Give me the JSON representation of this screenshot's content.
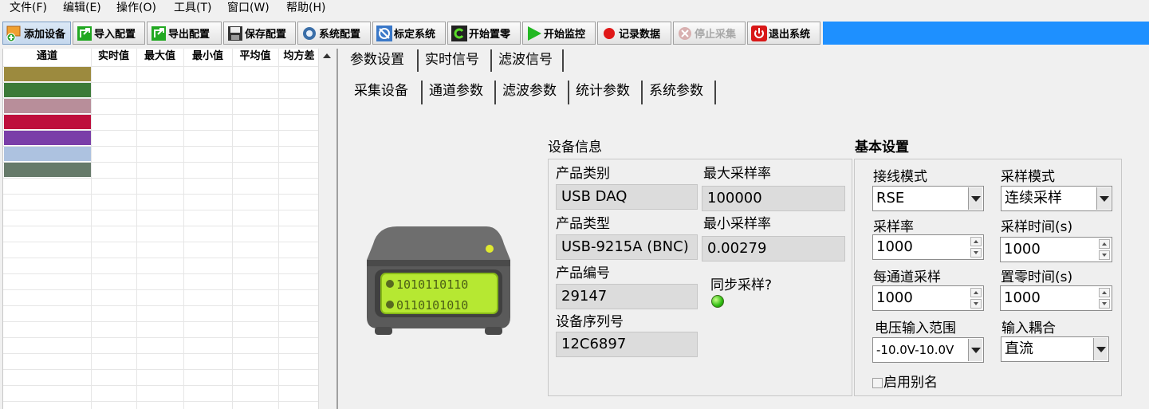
{
  "menu": [
    "文件(F)",
    "编辑(E)",
    "操作(O)",
    "工具(T)",
    "窗口(W)",
    "帮助(H)"
  ],
  "toolbar": {
    "buttons": [
      {
        "label": "添加设备",
        "icon": "add-device-icon",
        "active": true
      },
      {
        "label": "导入配置",
        "icon": "import-icon"
      },
      {
        "label": "导出配置",
        "icon": "export-icon"
      },
      {
        "label": "保存配置",
        "icon": "save-icon"
      },
      {
        "label": "系统配置",
        "icon": "system-config-icon"
      },
      {
        "label": "标定系统",
        "icon": "calibrate-icon"
      },
      {
        "label": "开始置零",
        "icon": "zero-icon"
      },
      {
        "label": "开始监控",
        "icon": "play-icon"
      },
      {
        "label": "记录数据",
        "icon": "record-icon"
      },
      {
        "label": "停止采集",
        "icon": "stop-icon",
        "disabled": true
      },
      {
        "label": "退出系统",
        "icon": "power-icon"
      }
    ],
    "colors": {
      "accent_bar": "#1e90ff"
    }
  },
  "table": {
    "columns": [
      "通道",
      "实时值",
      "最大值",
      "最小值",
      "平均值",
      "均方差"
    ],
    "channel_colors": [
      "#9c8a3e",
      "#3c7a38",
      "#b88e9a",
      "#be0e3c",
      "#7a3ea8",
      "#adc2e0",
      "#667a6a"
    ]
  },
  "tabs": {
    "main": [
      "参数设置",
      "实时信号",
      "滤波信号"
    ],
    "sub": [
      "采集设备",
      "通道参数",
      "滤波参数",
      "统计参数",
      "系统参数"
    ]
  },
  "device": {
    "title": "设备信息",
    "device_display": [
      "1010110110",
      "0110101010"
    ],
    "product_category_label": "产品类别",
    "product_category": "USB DAQ",
    "product_type_label": "产品类型",
    "product_type": "USB-9215A (BNC)",
    "product_number_label": "产品编号",
    "product_number": "29147",
    "serial_label": "设备序列号",
    "serial": "12C6897",
    "max_rate_label": "最大采样率",
    "max_rate": "100000",
    "min_rate_label": "最小采样率",
    "min_rate": "0.00279",
    "sync_label": "同步采样?"
  },
  "basic": {
    "title": "基本设置",
    "wiring_label": "接线模式",
    "wiring": "RSE",
    "sampling_mode_label": "采样模式",
    "sampling_mode": "连续采样",
    "rate_label": "采样率",
    "rate": "1000",
    "sample_time_label": "采样时间(s)",
    "sample_time": "1000",
    "per_channel_label": "每通道采样",
    "per_channel": "1000",
    "zero_time_label": "置零时间(s)",
    "zero_time": "1000",
    "voltage_label": "电压输入范围",
    "voltage": "-10.0V-10.0V",
    "coupling_label": "输入耦合",
    "coupling": "直流",
    "alias_label": "启用别名"
  }
}
